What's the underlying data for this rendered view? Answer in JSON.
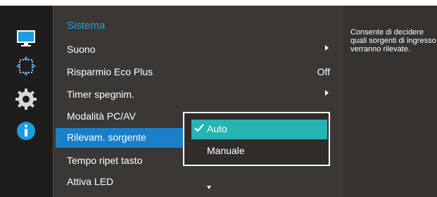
{
  "menu": {
    "title": "Sistema",
    "items": [
      {
        "label": "Suono",
        "value": "",
        "has_arrow": true
      },
      {
        "label": "Risparmio Eco Plus",
        "value": "Off",
        "has_arrow": false
      },
      {
        "label": "Timer spegnim.",
        "value": "",
        "has_arrow": true
      },
      {
        "label": "Modalità PC/AV",
        "value": "",
        "has_arrow": false
      },
      {
        "label": "Rilevam. sorgente",
        "value": "",
        "has_arrow": false
      },
      {
        "label": "Tempo ripet tasto",
        "value": "",
        "has_arrow": false
      },
      {
        "label": "Attiva LED",
        "value": "",
        "has_arrow": false
      }
    ]
  },
  "submenu": {
    "options": [
      {
        "label": "Auto",
        "checked": true
      },
      {
        "label": "Manuale",
        "checked": false
      }
    ]
  },
  "help": {
    "text": "Consente di decidere quali sorgenti di ingresso verranno rilevate."
  },
  "icons": {
    "rail": [
      "monitor-icon",
      "resize-icon",
      "gear-icon",
      "info-icon"
    ]
  },
  "colors": {
    "accent_blue": "#1a7fc8",
    "title_blue": "#1aa8d8",
    "highlight_teal": "#25b3b3"
  }
}
